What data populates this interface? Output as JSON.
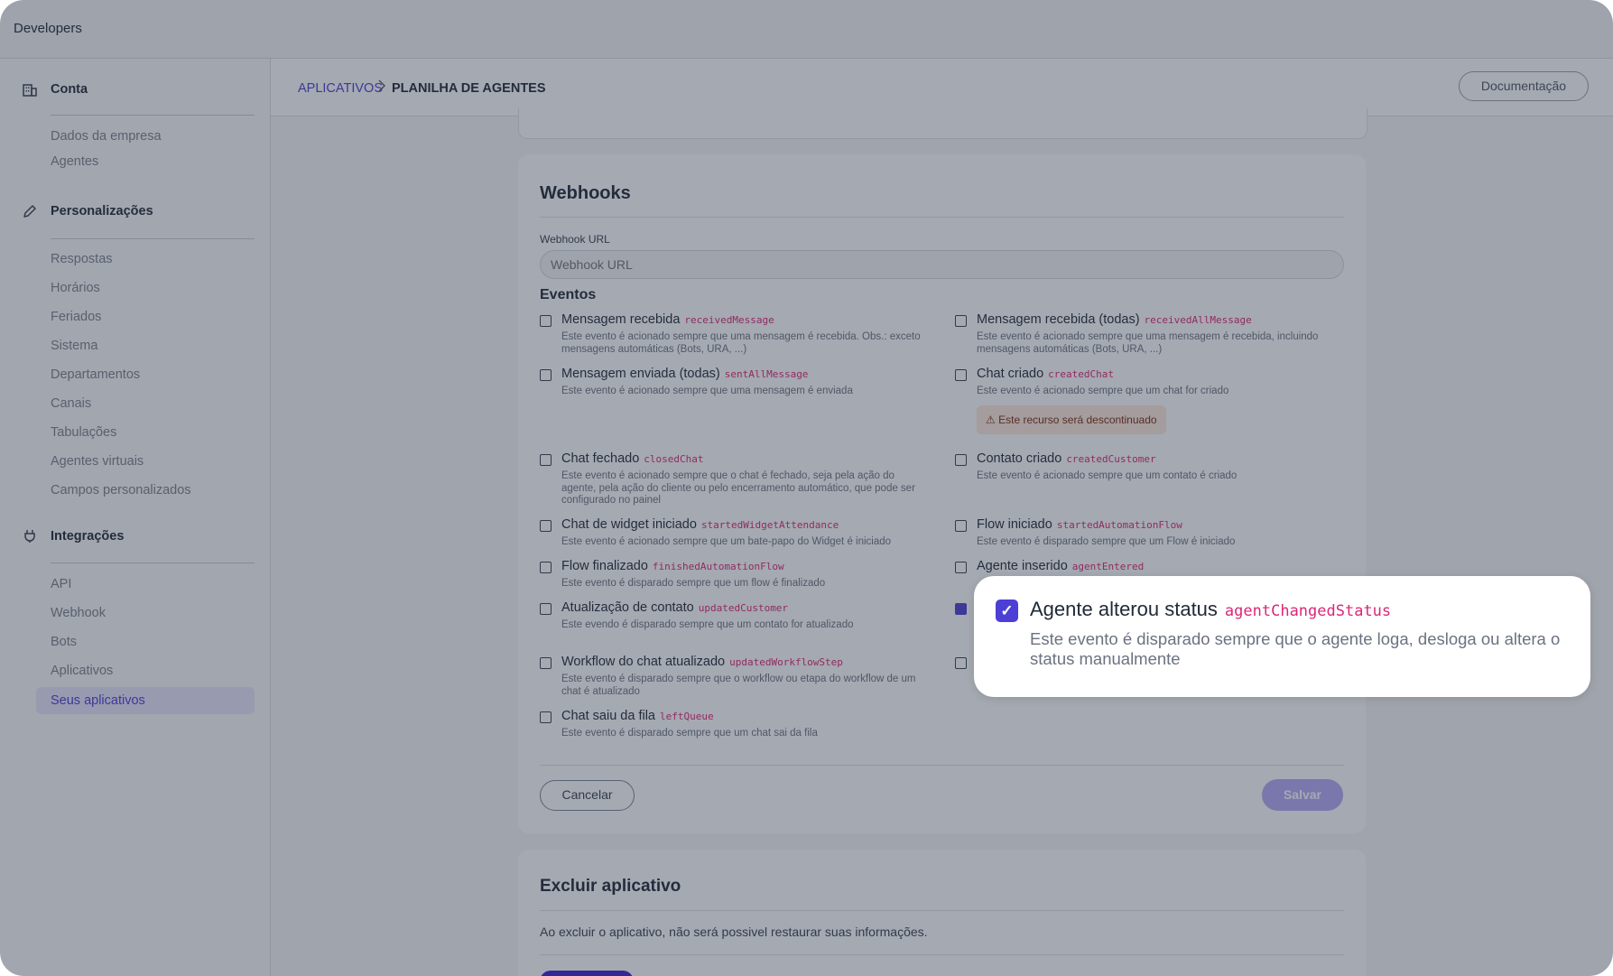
{
  "app": {
    "title": "Developers"
  },
  "sidebar": {
    "sections": [
      {
        "label": "Conta",
        "icon": "building-icon",
        "items": [
          "Dados da empresa",
          "Agentes"
        ]
      },
      {
        "label": "Personalizações",
        "icon": "pencil-icon",
        "items": [
          "Respostas",
          "Horários",
          "Feriados",
          "Sistema",
          "Departamentos",
          "Canais",
          "Tabulações",
          "Agentes virtuais",
          "Campos personalizados"
        ]
      },
      {
        "label": "Integrações",
        "icon": "plug-icon",
        "items": [
          "API",
          "Webhook",
          "Bots",
          "Aplicativos",
          "Seus aplicativos"
        ]
      }
    ],
    "active_item": "Seus aplicativos"
  },
  "header": {
    "breadcrumb_link": "APLICATIVOS",
    "breadcrumb_current": "PLANILHA DE AGENTES",
    "doc_button": "Documentação"
  },
  "webhooks": {
    "title": "Webhooks",
    "url_label": "Webhook URL",
    "url_placeholder": "Webhook URL",
    "url_value": "",
    "events_title": "Eventos",
    "events": [
      {
        "name": "Mensagem recebida",
        "code": "receivedMessage",
        "desc": "Este evento é acionado sempre que uma mensagem é recebida. Obs.: exceto mensagens automáticas (Bots, URA, ...)",
        "checked": false
      },
      {
        "name": "Mensagem recebida (todas)",
        "code": "receivedAllMessage",
        "desc": "Este evento é acionado sempre que uma mensagem é recebida, incluindo mensagens automáticas (Bots, URA, ...)",
        "checked": false
      },
      {
        "name": "Mensagem enviada (todas)",
        "code": "sentAllMessage",
        "desc": "Este evento é acionado sempre que uma mensagem é enviada",
        "checked": false
      },
      {
        "name": "Chat criado",
        "code": "createdChat",
        "desc": "Este evento é acionado sempre que um chat for criado",
        "checked": false
      },
      {
        "name": "Chat fechado",
        "code": "closedChat",
        "desc": "Este evento é acionado sempre que o chat é fechado, seja pela ação do agente, pela ação do cliente ou pelo encerramento automático, que pode ser configurado no painel",
        "checked": false
      },
      {
        "name": "Contato criado",
        "code": "createdCustomer",
        "desc": "Este evento é acionado sempre que um contato é criado",
        "checked": false
      },
      {
        "name": "Chat de widget iniciado",
        "code": "startedWidgetAttendance",
        "desc": "Este evento é acionado sempre que um bate-papo do Widget é iniciado",
        "checked": false
      },
      {
        "name": "Flow iniciado",
        "code": "startedAutomationFlow",
        "desc": "Este evento é disparado sempre que um Flow é iniciado",
        "checked": false
      },
      {
        "name": "Flow finalizado",
        "code": "finishedAutomationFlow",
        "desc": "Este evento é disparado sempre que um flow é finalizado",
        "checked": false
      },
      {
        "name": "Agente inserido",
        "code": "agentEntered",
        "desc": "",
        "checked": false
      },
      {
        "name": "Atualização de contato",
        "code": "updatedCustomer",
        "desc": "Este evendo é disparado sempre que um contato for atualizado",
        "checked": false
      },
      {
        "name": "Workflow do chat atualizado",
        "code": "updatedWorkflowStep",
        "desc": "Este evento é disparado sempre que o workflow ou etapa do workflow de um chat é atualizado",
        "checked": false
      },
      {
        "name": "Chat saiu da fila",
        "code": "leftQueue",
        "desc": "Este evento é disparado sempre que um chat sai da fila",
        "checked": false
      }
    ],
    "warning": "Este recurso será descontinuado",
    "cancel_label": "Cancelar",
    "save_label": "Salvar"
  },
  "delete_app": {
    "title": "Excluir aplicativo",
    "text": "Ao excluir o aplicativo, não será possivel restaurar suas informações."
  },
  "popup": {
    "name": "Agente alterou status",
    "code": "agentChangedStatus",
    "desc": "Este evento é disparado sempre que o agente loga, desloga ou altera o status manualmente",
    "checked": true
  },
  "colors": {
    "accent": "#4b3fd6",
    "code": "#db2777",
    "warning_bg": "#fde8dc"
  }
}
